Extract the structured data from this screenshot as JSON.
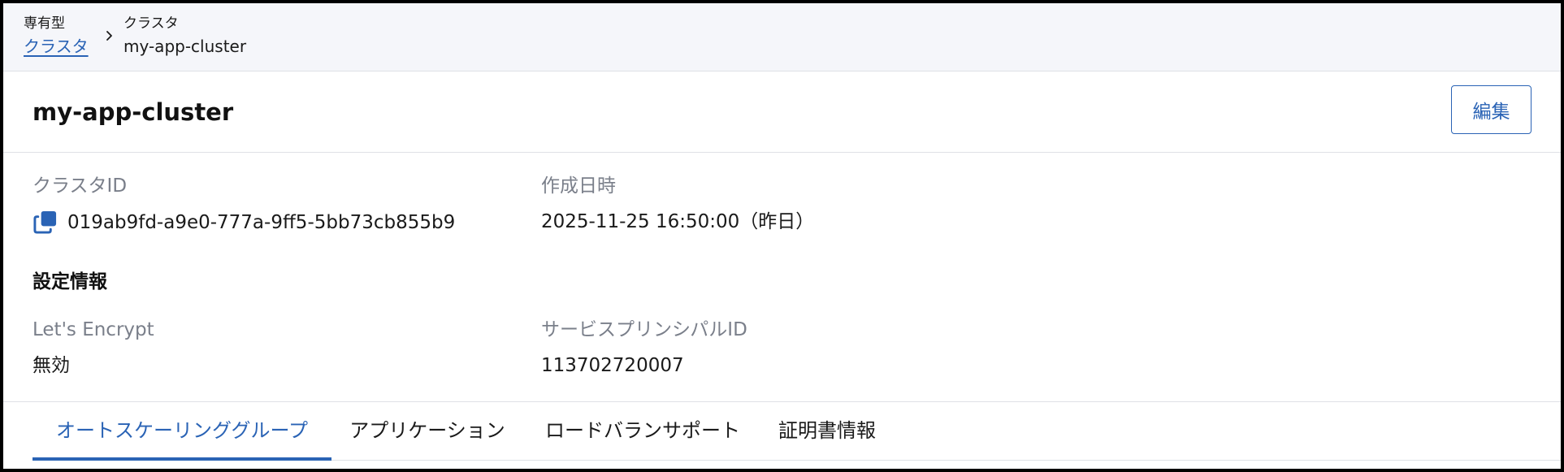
{
  "breadcrumb": {
    "items": [
      {
        "category": "専有型",
        "label": "クラスタ"
      },
      {
        "category": "クラスタ",
        "label": "my-app-cluster"
      }
    ]
  },
  "header": {
    "title": "my-app-cluster",
    "edit_label": "編集"
  },
  "details": {
    "cluster_id_label": "クラスタID",
    "cluster_id": "019ab9fd-a9e0-777a-9ff5-5bb73cb855b9",
    "created_label": "作成日時",
    "created_value": "2025-11-25 16:50:00（昨日）"
  },
  "settings": {
    "heading": "設定情報",
    "lets_encrypt_label": "Let's Encrypt",
    "lets_encrypt_value": "無効",
    "service_principal_label": "サービスプリンシパルID",
    "service_principal_value": "113702720007"
  },
  "tabs": [
    {
      "label": "オートスケーリンググループ",
      "active": true
    },
    {
      "label": "アプリケーション",
      "active": false
    },
    {
      "label": "ロードバランサポート",
      "active": false
    },
    {
      "label": "証明書情報",
      "active": false
    }
  ],
  "colors": {
    "accent": "#2a63b5",
    "breadcrumb_bg": "#f5f6fa",
    "label_gray": "#7a7f8a",
    "border": "#dfe1e6"
  },
  "icons": {
    "breadcrumb_separator": "chevron-right-icon",
    "copy": "copy-icon"
  }
}
